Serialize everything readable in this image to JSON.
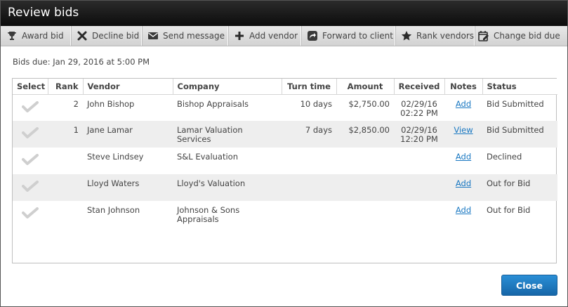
{
  "window": {
    "title": "Review bids"
  },
  "toolbar": {
    "award_bid": "Award bid",
    "decline_bid": "Decline bid",
    "send_message": "Send message",
    "add_vendor": "Add vendor",
    "forward_to_client": "Forward to client",
    "rank_vendors": "Rank vendors",
    "change_bid_due": "Change bid due"
  },
  "bids_due": "Bids due: Jan 29, 2016 at 5:00 PM",
  "table": {
    "headers": {
      "select": "Select",
      "rank": "Rank",
      "vendor": "Vendor",
      "company": "Company",
      "turn_time": "Turn time",
      "amount": "Amount",
      "received": "Received",
      "notes": "Notes",
      "status": "Status"
    },
    "rows": [
      {
        "rank": "2",
        "vendor": "John Bishop",
        "company": "Bishop Appraisals",
        "turn_time": "10 days",
        "amount": "$2,750.00",
        "received_date": "02/29/16",
        "received_time": "02:22 PM",
        "notes": "Add",
        "status": "Bid Submitted"
      },
      {
        "rank": "1",
        "vendor": "Jane Lamar",
        "company": "Lamar Valuation Services",
        "turn_time": "7 days",
        "amount": "$2,850.00",
        "received_date": "02/29/16",
        "received_time": "12:20 PM",
        "notes": "View",
        "status": "Bid Submitted"
      },
      {
        "rank": "",
        "vendor": "Steve Lindsey",
        "company": "S&L Evaluation",
        "turn_time": "",
        "amount": "",
        "received_date": "",
        "received_time": "",
        "notes": "Add",
        "status": "Declined"
      },
      {
        "rank": "",
        "vendor": "Lloyd Waters",
        "company": "Lloyd's Valuation",
        "turn_time": "",
        "amount": "",
        "received_date": "",
        "received_time": "",
        "notes": "Add",
        "status": "Out for Bid"
      },
      {
        "rank": "",
        "vendor": "Stan Johnson",
        "company_line1": "Johnson & Sons",
        "company_line2": "Appraisals",
        "turn_time": "",
        "amount": "",
        "received_date": "",
        "received_time": "",
        "notes": "Add",
        "status": "Out for Bid"
      }
    ]
  },
  "footer": {
    "close_label": "Close"
  },
  "icons": {
    "award_bid": "trophy-icon",
    "decline_bid": "x-icon",
    "send_message": "envelope-icon",
    "add_vendor": "plus-icon",
    "forward_to_client": "forward-arrow-icon",
    "rank_vendors": "star-icon",
    "change_bid_due": "calendar-edit-icon",
    "select": "checkmark-icon"
  },
  "colors": {
    "titlebar": "#0c0c0c",
    "link": "#1a78c2",
    "primary_button": "#1a78c2",
    "alt_row": "#eeeeee"
  }
}
